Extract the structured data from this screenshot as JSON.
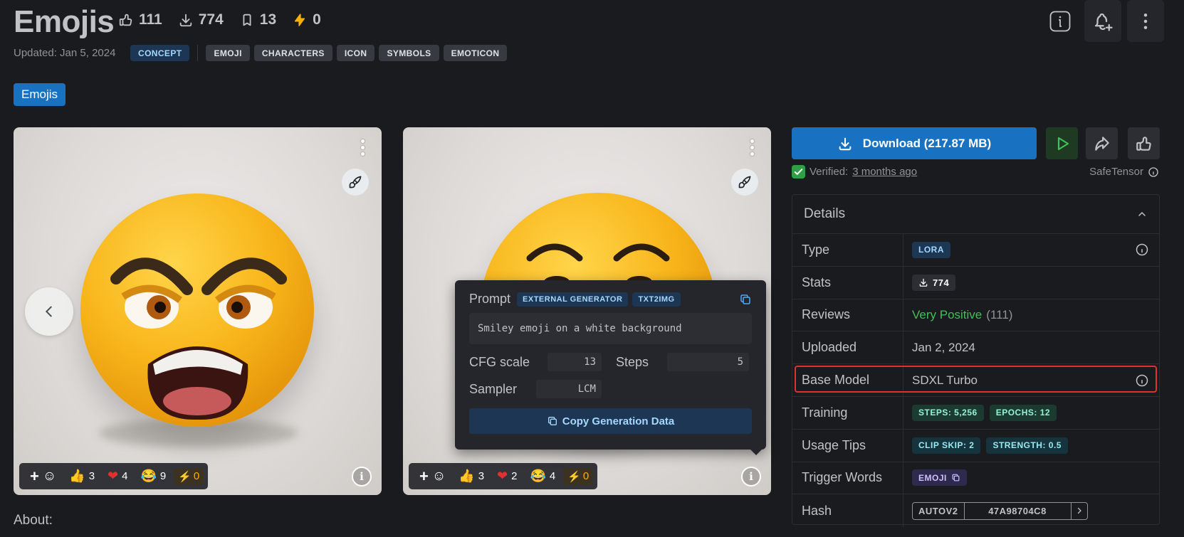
{
  "header": {
    "title": "Emojis",
    "stats": [
      {
        "icon": "thumbs-up-icon",
        "value": "111"
      },
      {
        "icon": "download-icon",
        "value": "774"
      },
      {
        "icon": "bookmark-icon",
        "value": "13"
      },
      {
        "icon": "bolt-icon",
        "value": "0"
      }
    ],
    "updated": "Updated: Jan 5, 2024",
    "category_tag": "CONCEPT",
    "tags": [
      "EMOJI",
      "CHARACTERS",
      "ICON",
      "SYMBOLS",
      "EMOTICON"
    ],
    "chip": "Emojis"
  },
  "gallery": [
    {
      "reactions": {
        "add": "+",
        "thumbs": "3",
        "heart": "4",
        "laugh": "9",
        "bolt": "0"
      }
    },
    {
      "reactions": {
        "add": "+",
        "thumbs": "3",
        "heart": "2",
        "laugh": "4",
        "bolt": "0"
      }
    }
  ],
  "popover": {
    "title": "Prompt",
    "badges": [
      "EXTERNAL GENERATOR",
      "TXT2IMG"
    ],
    "prompt": "Smiley emoji on a white background",
    "cfg_label": "CFG scale",
    "cfg_value": "13",
    "steps_label": "Steps",
    "steps_value": "5",
    "sampler_label": "Sampler",
    "sampler_value": "LCM",
    "copy_button": "Copy Generation Data"
  },
  "about": "About:",
  "sidebar": {
    "download": "Download (217.87 MB)",
    "verified_prefix": "Verified:",
    "verified_link": "3 months ago",
    "format": "SafeTensor",
    "details_title": "Details",
    "rows": {
      "type": {
        "label": "Type",
        "value": "LORA"
      },
      "stats": {
        "label": "Stats",
        "value": "774"
      },
      "reviews": {
        "label": "Reviews",
        "rating": "Very Positive",
        "count": "(111)"
      },
      "uploaded": {
        "label": "Uploaded",
        "value": "Jan 2, 2024"
      },
      "base_model": {
        "label": "Base Model",
        "value": "SDXL Turbo"
      },
      "training": {
        "label": "Training",
        "steps": "STEPS: 5,256",
        "epochs": "EPOCHS: 12"
      },
      "usage": {
        "label": "Usage Tips",
        "clip": "CLIP SKIP: 2",
        "strength": "STRENGTH: 0.5"
      },
      "trigger": {
        "label": "Trigger Words",
        "value": "EMOJI"
      },
      "hash": {
        "label": "Hash",
        "type": "AUTOV2",
        "value": "47A98704C8"
      }
    }
  },
  "colors": {
    "background": "#1a1b1e",
    "accent": "#1971c2",
    "positive": "#40c057",
    "highlight": "#e03131"
  }
}
